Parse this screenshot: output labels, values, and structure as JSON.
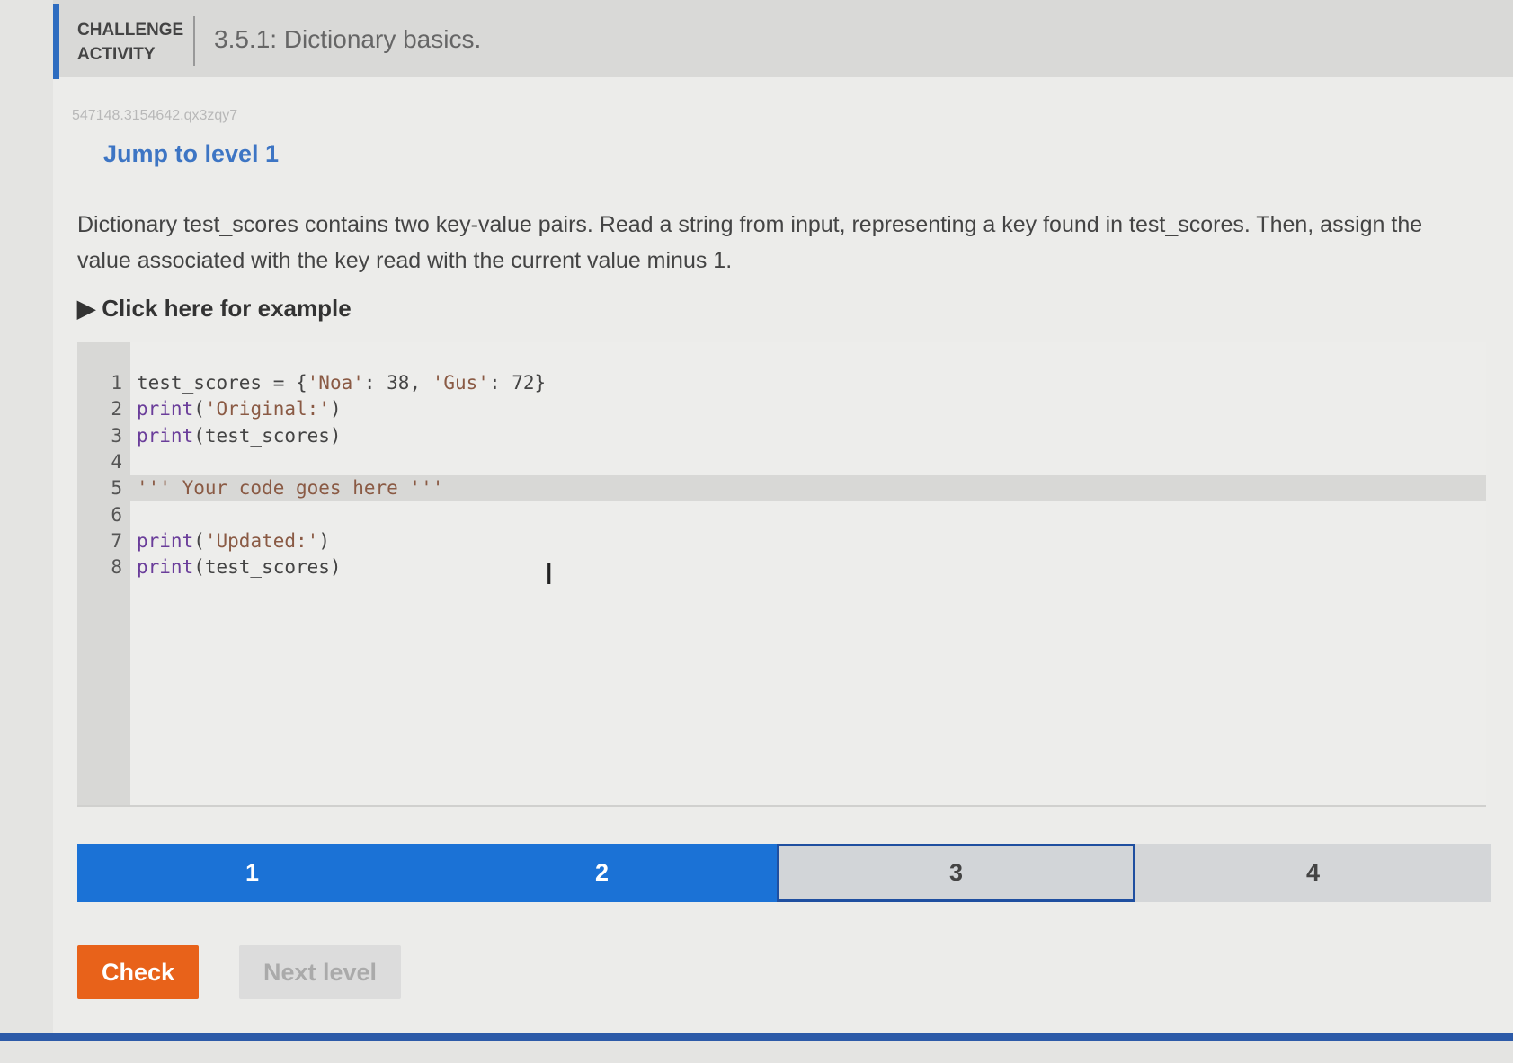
{
  "header": {
    "label_line1": "CHALLENGE",
    "label_line2": "ACTIVITY",
    "title": "3.5.1: Dictionary basics."
  },
  "activity_id": "547148.3154642.qx3zqy7",
  "jump_link": "Jump to level 1",
  "description": "Dictionary test_scores contains two key-value pairs. Read a string from input, representing a key found in test_scores. Then, assign the value associated with the key read with the current value minus 1.",
  "example_toggle": "▶ Click here for example",
  "editor": {
    "lines": [
      {
        "n": "1",
        "pre": "",
        "fn": "",
        "rest": "test_scores = {",
        "s1": "'Noa'",
        "m": ": 38, ",
        "s2": "'Gus'",
        "e": ": 72}"
      },
      {
        "n": "2",
        "fn": "print",
        "rest": "(",
        "s1": "'Original:'",
        "e": ")"
      },
      {
        "n": "3",
        "fn": "print",
        "rest": "(test_scores)"
      },
      {
        "n": "4"
      },
      {
        "n": "5",
        "s1": "''' Your code goes here '''"
      },
      {
        "n": "6"
      },
      {
        "n": "7",
        "fn": "print",
        "rest": "(",
        "s1": "'Updated:'",
        "e": ")"
      },
      {
        "n": "8",
        "fn": "print",
        "rest": "(test_scores)"
      }
    ]
  },
  "progress": {
    "levels": [
      "1",
      "2",
      "3",
      "4"
    ],
    "completed": 2,
    "current": 3,
    "colors": {
      "done": "#1b72d6",
      "current_border": "#1f4fa0"
    }
  },
  "buttons": {
    "check": "Check",
    "next": "Next level"
  },
  "colors": {
    "accent": "#2d6cc0",
    "check": "#e8621a"
  }
}
